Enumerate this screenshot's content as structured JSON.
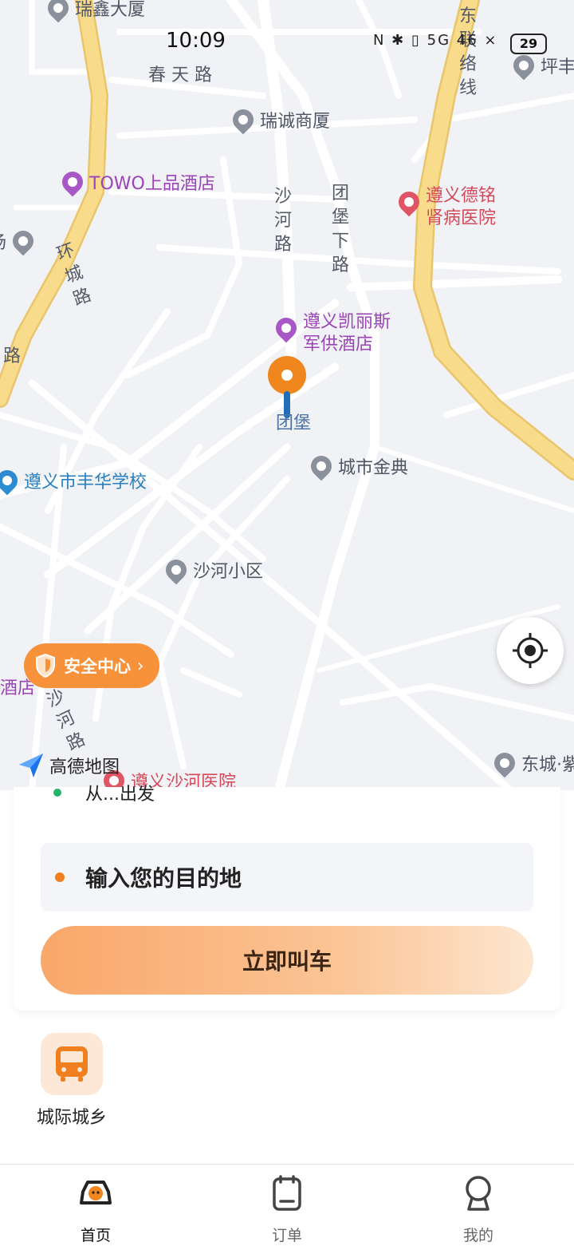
{
  "status_bar": {
    "time": "10:09",
    "icons": "N ✱ ▯ 5G 46 ×",
    "battery": "29"
  },
  "map": {
    "road_labels": {
      "chuntian": "春 天 路",
      "shahe": "沙河路",
      "tuanbaoxia": "团堡下路",
      "huancheng": "环城路",
      "dongluoxian": "东联络线",
      "left_edge": "路",
      "shahe_lower": "沙河路"
    },
    "pois": {
      "ruixin": "瑞鑫大厦",
      "ruicheng": "瑞诚商厦",
      "towo": "TOWO上品酒店",
      "deming_1": "遵义德铭",
      "deming_2": "肾病医院",
      "kailisi_1": "遵义凯丽斯",
      "kailisi_2": "军供酒店",
      "jindian": "城市金典",
      "fenghua": "遵义市丰华学校",
      "shahe_xiaoqu": "沙河小区",
      "shahe_hospital": "遵义沙河医院",
      "pingfeng": "坪丰",
      "dongcheng": "东城·紫",
      "hotel_edge": "酒店",
      "left_top": "场"
    },
    "marker_label": "团堡",
    "safety_center": "安全中心",
    "map_logo": "高德地图"
  },
  "trip_card": {
    "from_text": "从...出发",
    "destination_placeholder": "输入您的目的地",
    "call_button": "立即叫车"
  },
  "services": [
    {
      "label": "城际城乡",
      "icon": "bus-icon"
    }
  ],
  "tabs": [
    {
      "label": "首页",
      "icon": "car-home-icon",
      "active": true
    },
    {
      "label": "订单",
      "icon": "clipboard-icon",
      "active": false
    },
    {
      "label": "我的",
      "icon": "user-icon",
      "active": false
    }
  ],
  "colors": {
    "accent": "#f0861e",
    "safety_bg": "#f7923a",
    "road_major": "#f8dc8c",
    "map_bg": "#f1f2f5"
  }
}
